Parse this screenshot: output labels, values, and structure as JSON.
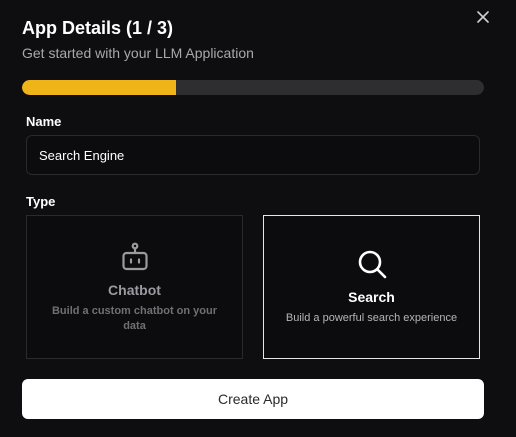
{
  "dialog": {
    "title": "App Details (1 / 3)",
    "subtitle": "Get started with your LLM Application",
    "close_icon": "close-icon"
  },
  "progress": {
    "fraction": 0.333,
    "fill_color": "#efb418",
    "track_color": "#2e2e31"
  },
  "form": {
    "name_label": "Name",
    "name_value": "Search Engine",
    "type_label": "Type",
    "types": [
      {
        "icon": "robot-icon",
        "title": "Chatbot",
        "description": "Build a custom chatbot on your data",
        "selected": false
      },
      {
        "icon": "search-icon",
        "title": "Search",
        "description": "Build a powerful search experience",
        "selected": true
      }
    ]
  },
  "footer": {
    "create_label": "Create App"
  }
}
